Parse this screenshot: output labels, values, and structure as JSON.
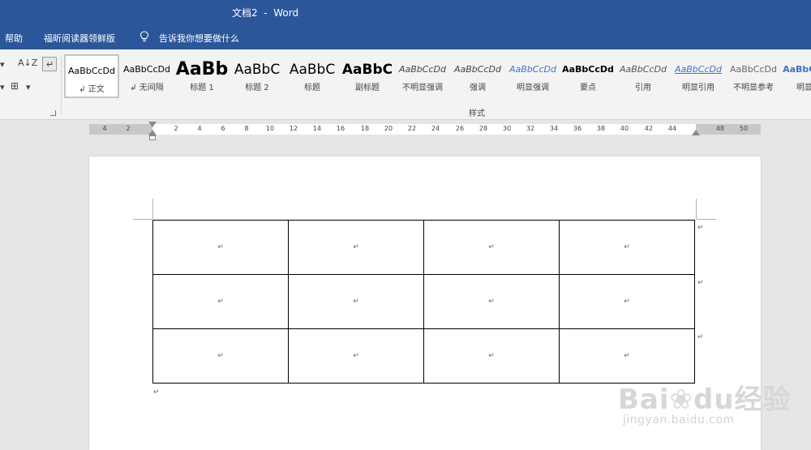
{
  "window": {
    "title": "文档2  -  Word"
  },
  "menu": {
    "items": [
      "帮助",
      "福昕阅读器领鲜版"
    ],
    "tell_me": "告诉我你想要做什么"
  },
  "ribbon": {
    "sort_icon_label": "A↓Z",
    "styles_group_label": "样式",
    "styles": [
      {
        "sample": "AaBbCcDd",
        "name": "↲ 正文"
      },
      {
        "sample": "AaBbCcDd",
        "name": "↲ 无间隔"
      },
      {
        "sample": "AaBb",
        "name": "标题 1"
      },
      {
        "sample": "AaBbC",
        "name": "标题 2"
      },
      {
        "sample": "AaBbC",
        "name": "标题"
      },
      {
        "sample": "AaBbC",
        "name": "副标题"
      },
      {
        "sample": "AaBbCcDd",
        "name": "不明显强调"
      },
      {
        "sample": "AaBbCcDd",
        "name": "强调"
      },
      {
        "sample": "AaBbCcDd",
        "name": "明显强调"
      },
      {
        "sample": "AaBbCcDd",
        "name": "要点"
      },
      {
        "sample": "AaBbCcDd",
        "name": "引用"
      },
      {
        "sample": "AaBbCcDd",
        "name": "明显引用"
      },
      {
        "sample": "AaBbCcDd",
        "name": "不明显参考"
      },
      {
        "sample": "AaBbCcDd",
        "name": "明显参"
      }
    ]
  },
  "ruler": {
    "numbers": [
      "4",
      "2",
      "2",
      "4",
      "6",
      "8",
      "10",
      "12",
      "14",
      "16",
      "18",
      "20",
      "22",
      "24",
      "26",
      "28",
      "30",
      "32",
      "34",
      "36",
      "38",
      "40",
      "42",
      "44",
      "48",
      "50"
    ]
  },
  "document": {
    "paragraph_mark": "↵",
    "table": {
      "rows": 3,
      "cols": 4
    }
  },
  "watermark": {
    "brand": "Bai",
    "brand2": "du",
    "suffix": "经验",
    "url": "jingyan.baidu.com"
  }
}
